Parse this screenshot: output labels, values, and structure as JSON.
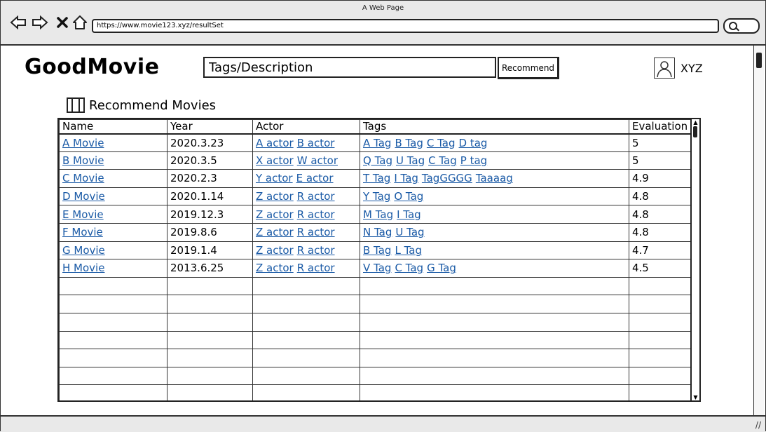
{
  "window": {
    "title": "A Web Page"
  },
  "browser": {
    "url": "https://www.movie123.xyz/resultSet",
    "back_icon": "arrow-left-icon",
    "forward_icon": "arrow-right-icon",
    "close_icon": "close-icon",
    "home_icon": "home-icon",
    "search_icon": "search-icon"
  },
  "header": {
    "logo": "GoodMovie",
    "search": {
      "placeholder": "Tags/Description",
      "button": "Recommend"
    },
    "user": {
      "name": "XYZ",
      "avatar_icon": "user-avatar-icon"
    }
  },
  "section": {
    "title": "Recommend Movies",
    "icon": "film-icon"
  },
  "table": {
    "columns": [
      "Name",
      "Year",
      "Actor",
      "Tags",
      "Evaluation"
    ],
    "rows": [
      {
        "name": "A Movie",
        "year": "2020.3.23",
        "actors": [
          "A actor",
          "B actor"
        ],
        "tags": [
          "A Tag",
          "B Tag",
          "C Tag",
          "D tag"
        ],
        "evaluation": "5"
      },
      {
        "name": "B Movie",
        "year": "2020.3.5",
        "actors": [
          "X actor",
          "W actor"
        ],
        "tags": [
          "Q Tag",
          "U Tag",
          "C Tag",
          "P tag"
        ],
        "evaluation": "5"
      },
      {
        "name": "C Movie",
        "year": "2020.2.3",
        "actors": [
          "Y actor",
          "E actor"
        ],
        "tags": [
          "T Tag",
          "I Tag",
          "TagGGGG",
          "Taaaag"
        ],
        "evaluation": "4.9"
      },
      {
        "name": "D Movie",
        "year": "2020.1.14",
        "actors": [
          "Z actor",
          "R actor"
        ],
        "tags": [
          "Y Tag",
          "O Tag"
        ],
        "evaluation": "4.8"
      },
      {
        "name": "E Movie",
        "year": "2019.12.3",
        "actors": [
          "Z actor",
          "R actor"
        ],
        "tags": [
          "M Tag",
          "I Tag"
        ],
        "evaluation": "4.8"
      },
      {
        "name": "F Movie",
        "year": "2019.8.6",
        "actors": [
          "Z actor",
          "R actor"
        ],
        "tags": [
          "N Tag",
          "U Tag"
        ],
        "evaluation": "4.8"
      },
      {
        "name": "G Movie",
        "year": "2019.1.4",
        "actors": [
          "Z actor",
          "R actor"
        ],
        "tags": [
          "B Tag",
          "L Tag"
        ],
        "evaluation": "4.7"
      },
      {
        "name": "H Movie",
        "year": "2013.6.25",
        "actors": [
          "Z actor",
          "R actor"
        ],
        "tags": [
          "V Tag",
          "C Tag",
          "G Tag"
        ],
        "evaluation": "4.5"
      }
    ],
    "empty_rows": 7
  },
  "colors": {
    "link": "#1a5aa6",
    "chrome": "#e9e9e9",
    "border": "#222222"
  }
}
